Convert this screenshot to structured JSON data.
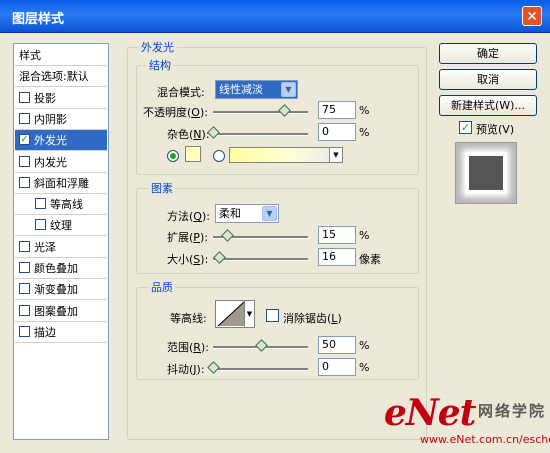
{
  "window": {
    "title": "图层样式",
    "close": "✕"
  },
  "sidebar": {
    "items": [
      {
        "label": "样式",
        "checkbox": false,
        "checked": false
      },
      {
        "label": "混合选项:默认",
        "checkbox": false,
        "checked": false
      },
      {
        "label": "投影",
        "checkbox": true,
        "checked": false
      },
      {
        "label": "内阴影",
        "checkbox": true,
        "checked": false
      },
      {
        "label": "外发光",
        "checkbox": true,
        "checked": true,
        "selected": true
      },
      {
        "label": "内发光",
        "checkbox": true,
        "checked": false
      },
      {
        "label": "斜面和浮雕",
        "checkbox": true,
        "checked": false
      },
      {
        "label": "等高线",
        "checkbox": true,
        "checked": false,
        "indent": true
      },
      {
        "label": "纹理",
        "checkbox": true,
        "checked": false,
        "indent": true
      },
      {
        "label": "光泽",
        "checkbox": true,
        "checked": false
      },
      {
        "label": "颜色叠加",
        "checkbox": true,
        "checked": false
      },
      {
        "label": "渐变叠加",
        "checkbox": true,
        "checked": false
      },
      {
        "label": "图案叠加",
        "checkbox": true,
        "checked": false
      },
      {
        "label": "描边",
        "checkbox": true,
        "checked": false
      }
    ]
  },
  "main": {
    "section_title": "外发光",
    "structure": {
      "title": "结构",
      "blend_mode_label": "混合模式:",
      "blend_mode_value": "线性减淡",
      "opacity_label": "不透明度",
      "opacity_key": "O",
      "opacity_value": "75",
      "opacity_unit": "%",
      "opacity_fraction": 0.75,
      "noise_label": "杂色",
      "noise_key": "N",
      "noise_value": "0",
      "noise_unit": "%",
      "noise_fraction": 0.0,
      "color_swatch": "#ffffc0",
      "gradient_start": "#ffffa0"
    },
    "elements": {
      "title": "图素",
      "technique_label": "方法",
      "technique_key": "Q",
      "technique_value": "柔和",
      "spread_label": "扩展",
      "spread_key": "P",
      "spread_value": "15",
      "spread_unit": "%",
      "spread_fraction": 0.15,
      "size_label": "大小",
      "size_key": "S",
      "size_value": "16",
      "size_unit": "像素",
      "size_fraction": 0.064
    },
    "quality": {
      "title": "品质",
      "contour_label": "等高线:",
      "antialias_label": "消除锯齿",
      "antialias_key": "L",
      "antialias_checked": false,
      "range_label": "范围",
      "range_key": "R",
      "range_value": "50",
      "range_unit": "%",
      "range_fraction": 0.5,
      "jitter_label": "抖动",
      "jitter_key": "J",
      "jitter_value": "0",
      "jitter_unit": "%",
      "jitter_fraction": 0.0
    }
  },
  "buttons": {
    "ok": "确定",
    "cancel": "取消",
    "new_style": "新建样式(W)...",
    "preview_label": "预览(V)",
    "preview_checked": true
  },
  "watermark": {
    "logo": "eNet",
    "logo_cn": "网络学院",
    "url": "www.eNet.com.cn/eschool"
  }
}
